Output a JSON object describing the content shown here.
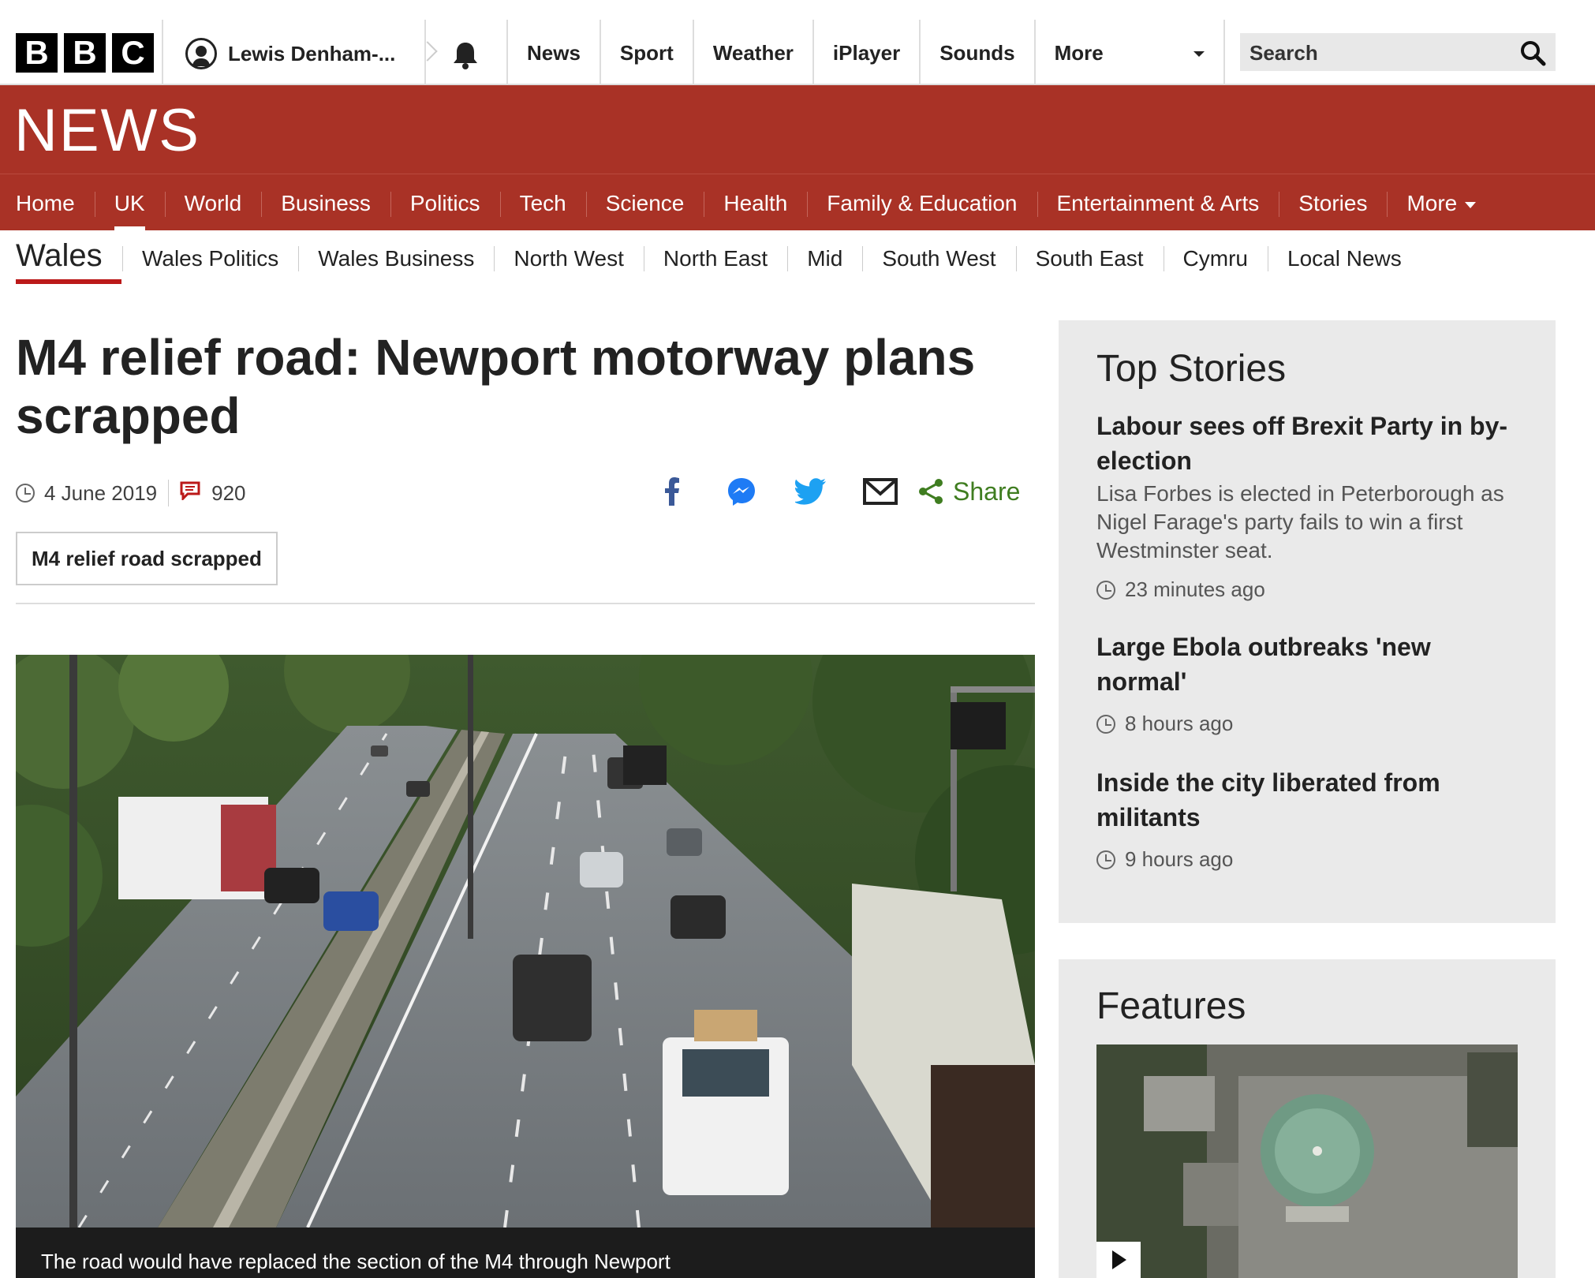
{
  "global_nav": {
    "logo_letters": [
      "B",
      "B",
      "C"
    ],
    "account_name": "Lewis Denham-...",
    "items": [
      "News",
      "Sport",
      "Weather",
      "iPlayer",
      "Sounds",
      "More"
    ],
    "search_placeholder": "Search"
  },
  "brand": {
    "wordmark": "NEWS",
    "color": "#a93226"
  },
  "primary_nav": {
    "items": [
      "Home",
      "UK",
      "World",
      "Business",
      "Politics",
      "Tech",
      "Science",
      "Health",
      "Family & Education",
      "Entertainment & Arts",
      "Stories",
      "More"
    ],
    "active": "UK"
  },
  "secondary_nav": {
    "title": "Wales",
    "items": [
      "Wales Politics",
      "Wales Business",
      "North West",
      "North East",
      "Mid",
      "South West",
      "South East",
      "Cymru",
      "Local News"
    ]
  },
  "article": {
    "headline": "M4 relief road: Newport motorway plans scrapped",
    "date": "4 June 2019",
    "comment_count": "920",
    "share_label": "Share",
    "share_icons": [
      "facebook-icon",
      "messenger-icon",
      "twitter-icon",
      "email-icon",
      "share-icon"
    ],
    "tag": "M4 relief road scrapped",
    "image_caption": "The road would have replaced the section of the M4 through Newport"
  },
  "top_stories": {
    "heading": "Top Stories",
    "stories": [
      {
        "title": "Labour sees off Brexit Party in by-election",
        "summary": "Lisa Forbes is elected in Peterborough as Nigel Farage's party fails to win a first Westminster seat.",
        "time": "23 minutes ago"
      },
      {
        "title": "Large Ebola outbreaks 'new normal'",
        "time": "8 hours ago"
      },
      {
        "title": "Inside the city liberated from militants",
        "time": "9 hours ago"
      }
    ]
  },
  "features": {
    "heading": "Features"
  }
}
